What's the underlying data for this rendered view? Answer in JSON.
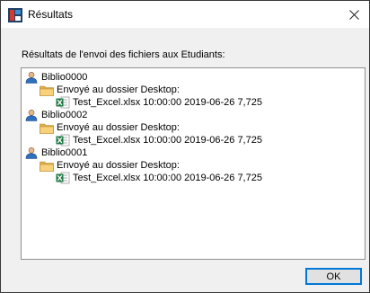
{
  "window": {
    "title": "Résultats",
    "app_icon": "window-app-icon",
    "close_icon": "close-icon",
    "close_symbol": "×"
  },
  "caption": "Résultats de l'envoi des fichiers aux Etudiants:",
  "results": [
    {
      "user": "Biblio0000",
      "folder": "Envoyé au dossier Desktop:",
      "file": "Test_Excel.xlsx 10:00:00 2019-06-26 7,725"
    },
    {
      "user": "Biblio0002",
      "folder": "Envoyé au dossier Desktop:",
      "file": "Test_Excel.xlsx 10:00:00 2019-06-26 7,725"
    },
    {
      "user": "Biblio0001",
      "folder": "Envoyé au dossier Desktop:",
      "file": "Test_Excel.xlsx 10:00:00 2019-06-26 7,725"
    }
  ],
  "icons": {
    "user": "user-icon",
    "folder": "folder-icon",
    "file": "excel-file-icon"
  },
  "buttons": {
    "ok_label": "OK"
  }
}
